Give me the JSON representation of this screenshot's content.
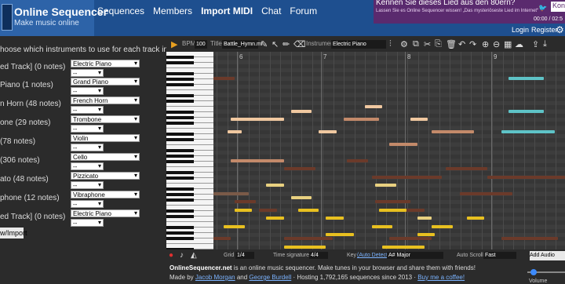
{
  "header": {
    "title": "Online Sequencer",
    "subtitle": "Make music online",
    "nav": [
      "Sequences",
      "Members",
      "Import MIDI",
      "Chat",
      "Forum"
    ],
    "login": "Login",
    "register": "Register"
  },
  "ad": {
    "title": "Kennen Sie dieses Lied aus den 80ern?",
    "subtitle": "Lassen Sie es Online Sequencer wissen! „Das mysteriöseste Lied im Internet“",
    "button": "Kont",
    "time": "00:00 / 02:5"
  },
  "import": {
    "instruction": "hoose which instruments to use for each track in the MIDI file.",
    "tracks": [
      {
        "name": "ed Track] (0 notes)",
        "instrument": "Electric Piano",
        "second": "--"
      },
      {
        "name": "Piano (1 notes)",
        "instrument": "Grand Piano",
        "second": "--"
      },
      {
        "name": "n Horn (48 notes)",
        "instrument": "French Horn",
        "second": "--"
      },
      {
        "name": "one (29 notes)",
        "instrument": "Trombone",
        "second": "--"
      },
      {
        "name": "(78 notes)",
        "instrument": "Violin",
        "second": "--"
      },
      {
        "name": "(306 notes)",
        "instrument": "Cello",
        "second": "--"
      },
      {
        "name": "ato (48 notes)",
        "instrument": "Pizzicato",
        "second": "--"
      },
      {
        "name": "phone (12 notes)",
        "instrument": "Vibraphone",
        "second": "--"
      },
      {
        "name": "ed Track] (0 notes)",
        "instrument": "Electric Piano",
        "second": "--"
      }
    ],
    "button": "w/Import"
  },
  "toolbar": {
    "bpm_label": "BPM",
    "bpm": "100",
    "title_label": "Title",
    "title": "Battle_Hymn.mi",
    "instrument_label": "Instrument",
    "instrument": "Electric Piano"
  },
  "roll": {
    "bar_numbers": [
      "6",
      "7",
      "8",
      "9"
    ],
    "notes": [
      {
        "lane": 6,
        "start": 0.0,
        "len": 0.06,
        "color": "#6b3a2a"
      },
      {
        "lane": 6,
        "start": 0.84,
        "len": 0.1,
        "color": "#5ec3c7"
      },
      {
        "lane": 14,
        "start": 0.22,
        "len": 0.06,
        "color": "#f0c8a0"
      },
      {
        "lane": 13,
        "start": 0.43,
        "len": 0.05,
        "color": "#f0c8a0"
      },
      {
        "lane": 16,
        "start": 0.05,
        "len": 0.15,
        "color": "#f0c8a0"
      },
      {
        "lane": 16,
        "start": 0.56,
        "len": 0.05,
        "color": "#f0c8a0"
      },
      {
        "lane": 14,
        "start": 0.84,
        "len": 0.1,
        "color": "#5ec3c7"
      },
      {
        "lane": 19,
        "start": 0.04,
        "len": 0.04,
        "color": "#f0c8a0"
      },
      {
        "lane": 19,
        "start": 0.3,
        "len": 0.05,
        "color": "#f0c8a0"
      },
      {
        "lane": 16,
        "start": 0.37,
        "len": 0.1,
        "color": "#c38a6a"
      },
      {
        "lane": 19,
        "start": 0.62,
        "len": 0.12,
        "color": "#c38a6a"
      },
      {
        "lane": 19,
        "start": 0.82,
        "len": 0.15,
        "color": "#5ec3c7"
      },
      {
        "lane": 22,
        "start": 0.5,
        "len": 0.08,
        "color": "#c38a6a"
      },
      {
        "lane": 26,
        "start": 0.05,
        "len": 0.15,
        "color": "#c38a6a"
      },
      {
        "lane": 26,
        "start": 0.38,
        "len": 0.06,
        "color": "#6b3a2a"
      },
      {
        "lane": 28,
        "start": 0.2,
        "len": 0.09,
        "color": "#6b3a2a"
      },
      {
        "lane": 28,
        "start": 0.66,
        "len": 0.12,
        "color": "#6b3a2a"
      },
      {
        "lane": 30,
        "start": 0.45,
        "len": 0.2,
        "color": "#6b3a2a"
      },
      {
        "lane": 30,
        "start": 0.78,
        "len": 0.22,
        "color": "#6b3a2a"
      },
      {
        "lane": 34,
        "start": 0.0,
        "len": 0.1,
        "color": "#7a5a48"
      },
      {
        "lane": 34,
        "start": 0.7,
        "len": 0.15,
        "color": "#6b3a2a"
      },
      {
        "lane": 36,
        "start": 0.06,
        "len": 0.06,
        "color": "#6b3a2a"
      },
      {
        "lane": 36,
        "start": 0.46,
        "len": 0.1,
        "color": "#6b3a2a"
      },
      {
        "lane": 38,
        "start": 0.13,
        "len": 0.05,
        "color": "#6b3a2a"
      },
      {
        "lane": 38,
        "start": 0.5,
        "len": 0.1,
        "color": "#6b3a2a"
      },
      {
        "lane": 32,
        "start": 0.15,
        "len": 0.05,
        "color": "#e8d080"
      },
      {
        "lane": 32,
        "start": 0.46,
        "len": 0.06,
        "color": "#e8d080"
      },
      {
        "lane": 35,
        "start": 0.22,
        "len": 0.06,
        "color": "#e8d080"
      },
      {
        "lane": 40,
        "start": 0.58,
        "len": 0.04,
        "color": "#e8d080"
      },
      {
        "lane": 38,
        "start": 0.06,
        "len": 0.05,
        "color": "#e8c020"
      },
      {
        "lane": 38,
        "start": 0.24,
        "len": 0.06,
        "color": "#e8c020"
      },
      {
        "lane": 38,
        "start": 0.47,
        "len": 0.08,
        "color": "#e8c020"
      },
      {
        "lane": 40,
        "start": 0.15,
        "len": 0.05,
        "color": "#e8c020"
      },
      {
        "lane": 40,
        "start": 0.32,
        "len": 0.05,
        "color": "#e8c020"
      },
      {
        "lane": 40,
        "start": 0.72,
        "len": 0.05,
        "color": "#e8c020"
      },
      {
        "lane": 42,
        "start": 0.03,
        "len": 0.06,
        "color": "#e8c020"
      },
      {
        "lane": 42,
        "start": 0.45,
        "len": 0.06,
        "color": "#e8c020"
      },
      {
        "lane": 42,
        "start": 0.62,
        "len": 0.06,
        "color": "#e8c020"
      },
      {
        "lane": 44,
        "start": 0.32,
        "len": 0.08,
        "color": "#e8c020"
      },
      {
        "lane": 44,
        "start": 0.58,
        "len": 0.05,
        "color": "#e8c020"
      },
      {
        "lane": 45,
        "start": 0.0,
        "len": 0.05,
        "color": "#6b3a2a"
      },
      {
        "lane": 45,
        "start": 0.2,
        "len": 0.14,
        "color": "#6b3a2a"
      },
      {
        "lane": 45,
        "start": 0.5,
        "len": 0.12,
        "color": "#6b3a2a"
      },
      {
        "lane": 45,
        "start": 0.82,
        "len": 0.16,
        "color": "#6b3a2a"
      },
      {
        "lane": 47,
        "start": 0.2,
        "len": 0.12,
        "color": "#e8c020"
      },
      {
        "lane": 47,
        "start": 0.48,
        "len": 0.12,
        "color": "#e8c020"
      }
    ]
  },
  "bottom": {
    "grid_label": "Grid",
    "grid": "1/4",
    "ts_label": "Time signature",
    "ts": "4/4",
    "key_label": "Key",
    "key_auto": "(Auto Detect)",
    "key": "A# Major",
    "scroll_label": "Auto Scroll",
    "scroll": "Fast",
    "add_track": "Add Audio Track"
  },
  "footer": {
    "line1_link": "OnlineSequencer.net",
    "line1": " is an online music sequencer. Make tunes in your browser and share them with friends!",
    "line2_a": "Made by ",
    "author1": "Jacob Morgan",
    "and": " and ",
    "author2": "George Burdell",
    "line2_b": " · Hosting 1,792,165 sequences since 2013 · ",
    "coffee": "Buy me a coffee!",
    "volume": "Volume"
  }
}
